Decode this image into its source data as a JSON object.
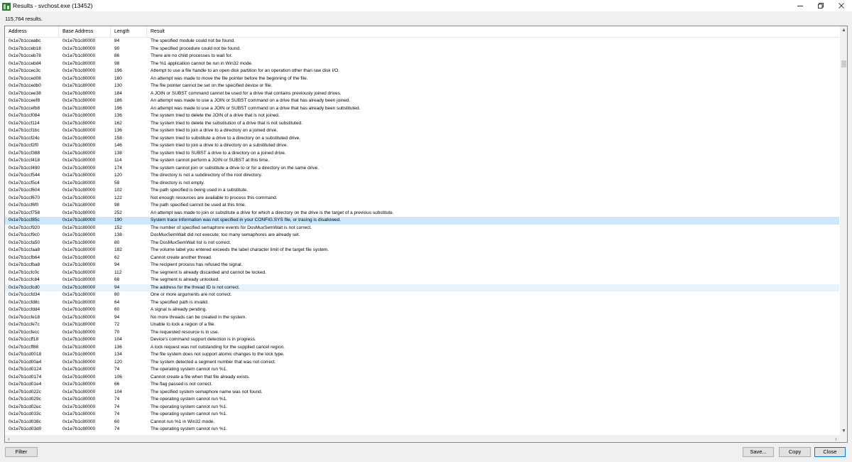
{
  "window": {
    "title": "Results - svchost.exe (13452)",
    "icon": "process-hacker-icon",
    "controls": [
      "minimize-icon",
      "maximize-icon",
      "close-icon"
    ]
  },
  "summary": {
    "count_text": "115,764 results."
  },
  "table": {
    "columns": [
      "Address",
      "Base Address",
      "Length",
      "Result"
    ],
    "selected_row_address": "0x1e7b1ccf85c",
    "hovered_row_address": "0x1e7b1ccfcd0",
    "rows": [
      {
        "address": "0x1e7b1cceabc",
        "base": "0x1e7b1c80000",
        "length": "84",
        "result": "The specified module could not be found."
      },
      {
        "address": "0x1e7b1cceb18",
        "base": "0x1e7b1c80000",
        "length": "90",
        "result": "The specified procedure could not be found."
      },
      {
        "address": "0x1e7b1cceb78",
        "base": "0x1e7b1c80000",
        "length": "86",
        "result": "There are no child processes to wait for."
      },
      {
        "address": "0x1e7b1ccebd4",
        "base": "0x1e7b1c80000",
        "length": "98",
        "result": "The %1 application cannot be run in Win32 mode."
      },
      {
        "address": "0x1e7b1ccec3c",
        "base": "0x1e7b1c80000",
        "length": "196",
        "result": "Attempt to use a file handle to an open disk partition for an operation other than raw disk I/O."
      },
      {
        "address": "0x1e7b1cced08",
        "base": "0x1e7b1c80000",
        "length": "160",
        "result": "An attempt was made to move the file pointer before the beginning of the file."
      },
      {
        "address": "0x1e7b1ccedb0",
        "base": "0x1e7b1c80000",
        "length": "130",
        "result": "The file pointer cannot be set on the specified device or file."
      },
      {
        "address": "0x1e7b1ccee38",
        "base": "0x1e7b1c80000",
        "length": "184",
        "result": "A JOIN or SUBST command cannot be used for a drive that contains previously joined drives."
      },
      {
        "address": "0x1e7b1cceef8",
        "base": "0x1e7b1c80000",
        "length": "186",
        "result": "An attempt was made to use a JOIN or SUBST command on a drive that has already been joined."
      },
      {
        "address": "0x1e7b1ccefb8",
        "base": "0x1e7b1c80000",
        "length": "196",
        "result": "An attempt was made to use a JOIN or SUBST command on a drive that has already been substituted."
      },
      {
        "address": "0x1e7b1ccf084",
        "base": "0x1e7b1c80000",
        "length": "136",
        "result": "The system tried to delete the JOIN of a drive that is not joined."
      },
      {
        "address": "0x1e7b1ccf114",
        "base": "0x1e7b1c80000",
        "length": "162",
        "result": "The system tried to delete the substitution of a drive that is not substituted."
      },
      {
        "address": "0x1e7b1ccf1bc",
        "base": "0x1e7b1c80000",
        "length": "136",
        "result": "The system tried to join a drive to a directory on a joined drive."
      },
      {
        "address": "0x1e7b1ccf24c",
        "base": "0x1e7b1c80000",
        "length": "158",
        "result": "The system tried to substitute a drive to a directory on a substituted drive."
      },
      {
        "address": "0x1e7b1ccf2f0",
        "base": "0x1e7b1c80000",
        "length": "146",
        "result": "The system tried to join a drive to a directory on a substituted drive."
      },
      {
        "address": "0x1e7b1ccf388",
        "base": "0x1e7b1c80000",
        "length": "138",
        "result": "The system tried to SUBST a drive to a directory on a joined drive."
      },
      {
        "address": "0x1e7b1ccf418",
        "base": "0x1e7b1c80000",
        "length": "114",
        "result": "The system cannot perform a JOIN or SUBST at this time."
      },
      {
        "address": "0x1e7b1ccf490",
        "base": "0x1e7b1c80000",
        "length": "174",
        "result": "The system cannot join or substitute a drive to or for a directory on the same drive."
      },
      {
        "address": "0x1e7b1ccf544",
        "base": "0x1e7b1c80000",
        "length": "120",
        "result": "The directory is not a subdirectory of the root directory."
      },
      {
        "address": "0x1e7b1ccf5c4",
        "base": "0x1e7b1c80000",
        "length": "58",
        "result": "The directory is not empty."
      },
      {
        "address": "0x1e7b1ccf604",
        "base": "0x1e7b1c80000",
        "length": "102",
        "result": "The path specified is being used in a substitute."
      },
      {
        "address": "0x1e7b1ccf670",
        "base": "0x1e7b1c80000",
        "length": "122",
        "result": "Not enough resources are available to process this command."
      },
      {
        "address": "0x1e7b1ccf6f0",
        "base": "0x1e7b1c80000",
        "length": "98",
        "result": "The path specified cannot be used at this time."
      },
      {
        "address": "0x1e7b1ccf758",
        "base": "0x1e7b1c80000",
        "length": "252",
        "result": "An attempt was made to join or substitute a drive for which a directory on the drive is the target of a previous substitute."
      },
      {
        "address": "0x1e7b1ccf85c",
        "base": "0x1e7b1c80000",
        "length": "190",
        "result": "System trace information was not specified in your CONFIG.SYS file, or tracing is disallowed."
      },
      {
        "address": "0x1e7b1ccf920",
        "base": "0x1e7b1c80000",
        "length": "152",
        "result": "The number of specified semaphore events for DosMuxSemWait is not correct."
      },
      {
        "address": "0x1e7b1ccf9c0",
        "base": "0x1e7b1c80000",
        "length": "138",
        "result": "DosMuxSemWait did not execute; too many semaphores are already set."
      },
      {
        "address": "0x1e7b1ccfa50",
        "base": "0x1e7b1c80000",
        "length": "80",
        "result": "The DosMuxSemWait list is not correct."
      },
      {
        "address": "0x1e7b1ccfaa8",
        "base": "0x1e7b1c80000",
        "length": "182",
        "result": "The volume label you entered exceeds the label character limit of the target file system."
      },
      {
        "address": "0x1e7b1ccfb64",
        "base": "0x1e7b1c80000",
        "length": "62",
        "result": "Cannot create another thread."
      },
      {
        "address": "0x1e7b1ccfba8",
        "base": "0x1e7b1c80000",
        "length": "94",
        "result": "The recipient process has refused the signal."
      },
      {
        "address": "0x1e7b1ccfc0c",
        "base": "0x1e7b1c80000",
        "length": "112",
        "result": "The segment is already discarded and cannot be locked."
      },
      {
        "address": "0x1e7b1ccfc84",
        "base": "0x1e7b1c80000",
        "length": "68",
        "result": "The segment is already unlocked."
      },
      {
        "address": "0x1e7b1ccfcd0",
        "base": "0x1e7b1c80000",
        "length": "94",
        "result": "The address for the thread ID is not correct."
      },
      {
        "address": "0x1e7b1ccfd34",
        "base": "0x1e7b1c80000",
        "length": "80",
        "result": "One or more arguments are not correct."
      },
      {
        "address": "0x1e7b1ccfd8c",
        "base": "0x1e7b1c80000",
        "length": "64",
        "result": "The specified path is invalid."
      },
      {
        "address": "0x1e7b1ccfdd4",
        "base": "0x1e7b1c80000",
        "length": "60",
        "result": "A signal is already pending."
      },
      {
        "address": "0x1e7b1ccfe18",
        "base": "0x1e7b1c80000",
        "length": "94",
        "result": "No more threads can be created in the system."
      },
      {
        "address": "0x1e7b1ccfe7c",
        "base": "0x1e7b1c80000",
        "length": "72",
        "result": "Unable to lock a region of a file."
      },
      {
        "address": "0x1e7b1ccfecc",
        "base": "0x1e7b1c80000",
        "length": "70",
        "result": "The requested resource is in use."
      },
      {
        "address": "0x1e7b1ccff18",
        "base": "0x1e7b1c80000",
        "length": "104",
        "result": "Device's command support detection is in progress."
      },
      {
        "address": "0x1e7b1ccff88",
        "base": "0x1e7b1c80000",
        "length": "136",
        "result": "A lock request was not outstanding for the supplied cancel region."
      },
      {
        "address": "0x1e7b1cd0018",
        "base": "0x1e7b1c80000",
        "length": "134",
        "result": "The file system does not support atomic changes to the lock type."
      },
      {
        "address": "0x1e7b1cd00a4",
        "base": "0x1e7b1c80000",
        "length": "120",
        "result": "The system detected a segment number that was not correct."
      },
      {
        "address": "0x1e7b1cd0124",
        "base": "0x1e7b1c80000",
        "length": "74",
        "result": "The operating system cannot run %1."
      },
      {
        "address": "0x1e7b1cd0174",
        "base": "0x1e7b1c80000",
        "length": "106",
        "result": "Cannot create a file when that file already exists."
      },
      {
        "address": "0x1e7b1cd01e4",
        "base": "0x1e7b1c80000",
        "length": "66",
        "result": "The flag passed is not correct."
      },
      {
        "address": "0x1e7b1cd022c",
        "base": "0x1e7b1c80000",
        "length": "104",
        "result": "The specified system semaphore name was not found."
      },
      {
        "address": "0x1e7b1cd029c",
        "base": "0x1e7b1c80000",
        "length": "74",
        "result": "The operating system cannot run %1."
      },
      {
        "address": "0x1e7b1cd02ec",
        "base": "0x1e7b1c80000",
        "length": "74",
        "result": "The operating system cannot run %1."
      },
      {
        "address": "0x1e7b1cd033c",
        "base": "0x1e7b1c80000",
        "length": "74",
        "result": "The operating system cannot run %1."
      },
      {
        "address": "0x1e7b1cd038c",
        "base": "0x1e7b1c80000",
        "length": "60",
        "result": "Cannot run %1 in Win32 mode."
      },
      {
        "address": "0x1e7b1cd03d0",
        "base": "0x1e7b1c80000",
        "length": "74",
        "result": "The operating system cannot run %1."
      }
    ]
  },
  "buttons": {
    "filter": "Filter",
    "save": "Save...",
    "copy": "Copy",
    "close": "Close"
  },
  "colors": {
    "selected_row": "#cce8ff",
    "hovered_row": "#e5f3ff",
    "default_button_border": "#0078d7"
  }
}
